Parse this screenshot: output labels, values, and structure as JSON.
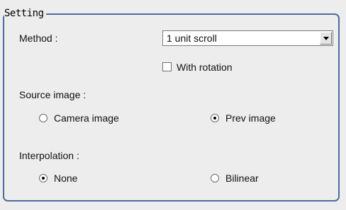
{
  "setting": {
    "title": "Setting",
    "method": {
      "label": "Method :",
      "selected": "1 unit scroll",
      "with_rotation": {
        "label": "With rotation",
        "checked": false
      }
    },
    "source_image": {
      "label": "Source image :",
      "options": [
        {
          "label": "Camera image",
          "selected": false
        },
        {
          "label": "Prev image",
          "selected": true
        }
      ]
    },
    "interpolation": {
      "label": "Interpolation :",
      "options": [
        {
          "label": "None",
          "selected": true
        },
        {
          "label": "Bilinear",
          "selected": false
        }
      ]
    }
  },
  "colors": {
    "group_border": "#4a6d9c",
    "background": "#ededed"
  },
  "icons": {
    "dropdown": "chevron-down-icon",
    "checkbox": "checkbox-icon",
    "radio": "radio-icon"
  }
}
